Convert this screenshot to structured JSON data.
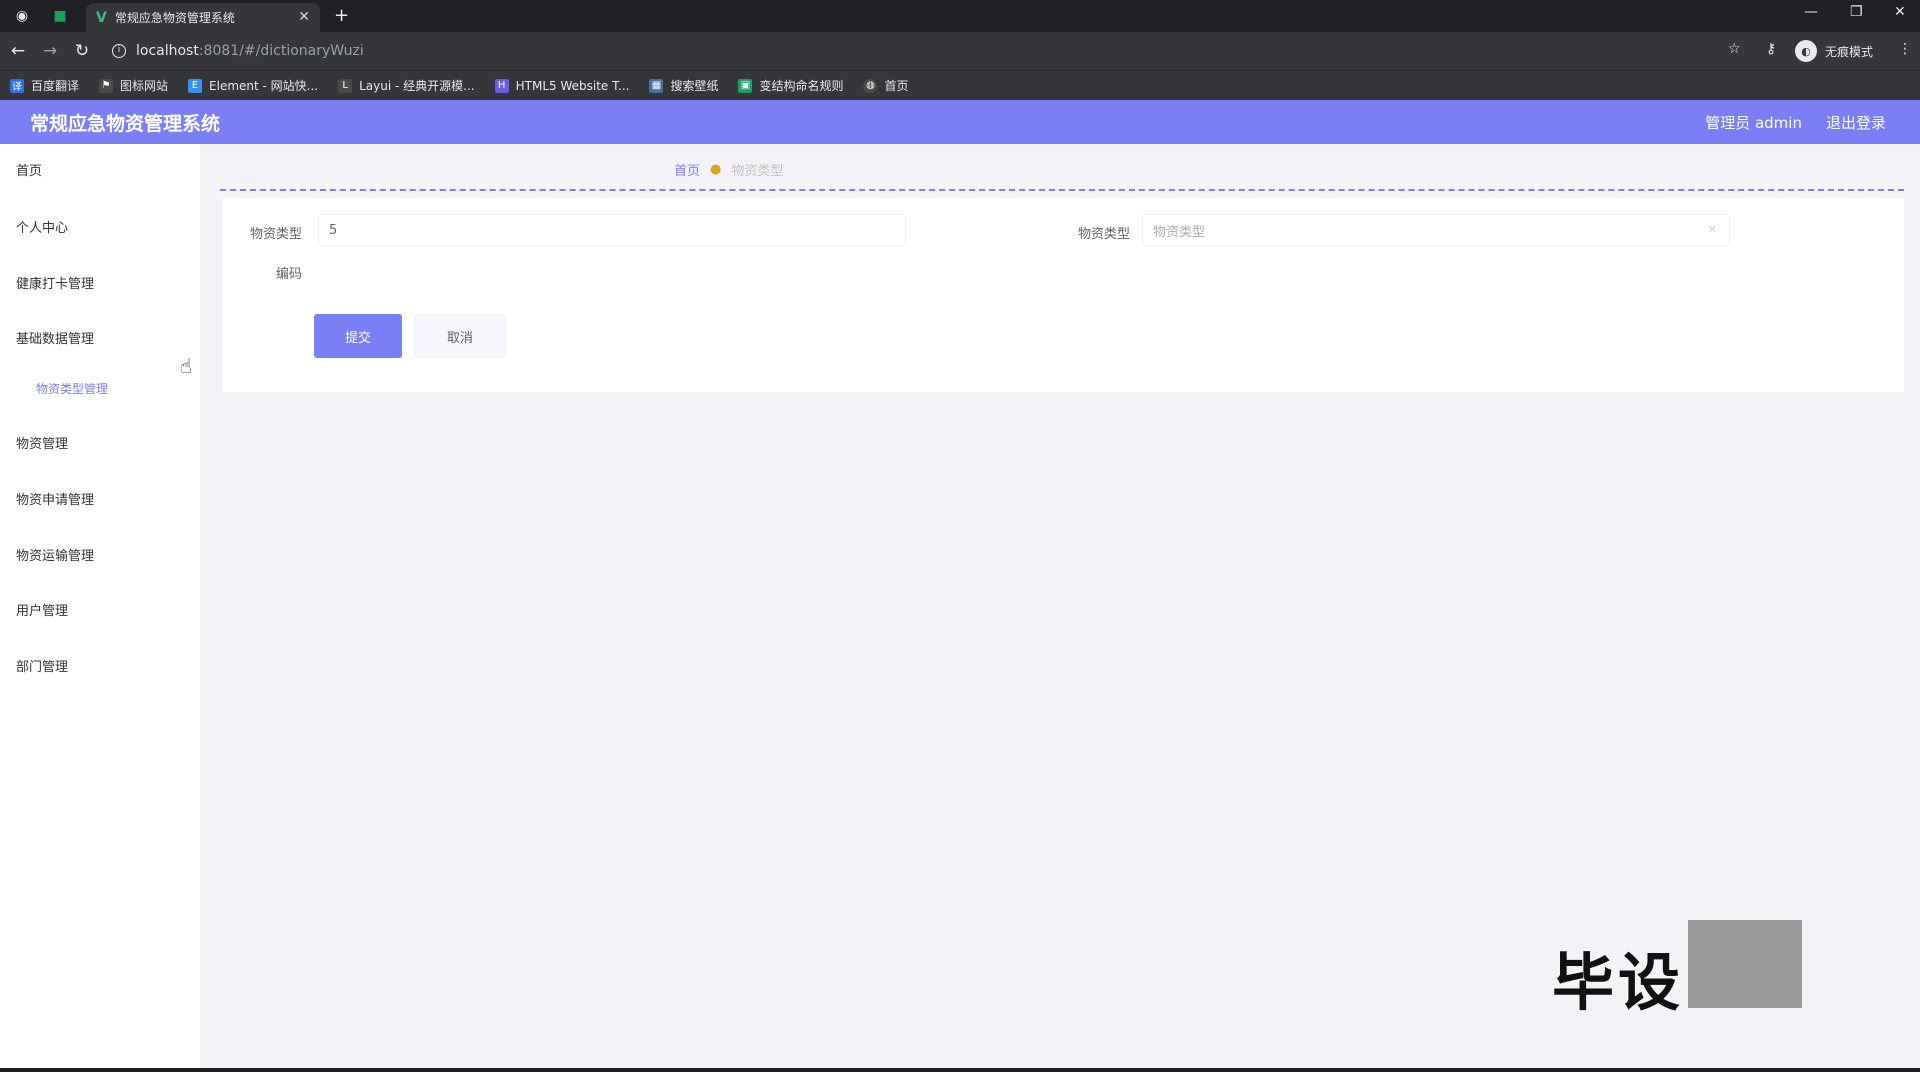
{
  "browser": {
    "tab_title": "常规应急物资管理系统",
    "url_host": "localhost",
    "url_path": ":8081/#/dictionaryWuzi",
    "incognito_label": "无痕模式",
    "bookmarks": [
      {
        "label": "百度翻译",
        "color": "#2f6fe4"
      },
      {
        "label": "图标网站",
        "color": "#4a4a4a"
      },
      {
        "label": "Element - 网站快...",
        "color": "#3d8ef0"
      },
      {
        "label": "Layui - 经典开源模...",
        "color": "#4a4a4a"
      },
      {
        "label": "HTML5 Website T...",
        "color": "#6c5ce7"
      },
      {
        "label": "搜索壁纸",
        "color": "#4a6fa5"
      },
      {
        "label": "变结构命名规则",
        "color": "#1aa260"
      },
      {
        "label": "首页",
        "color": "#4a4a4a"
      }
    ]
  },
  "header": {
    "title": "常规应急物资管理系统",
    "user": "管理员 admin",
    "logout": "退出登录",
    "accent": "#7b7ff5"
  },
  "sidebar": {
    "items": [
      {
        "label": "首页"
      },
      {
        "label": "个人中心"
      },
      {
        "label": "健康打卡管理"
      },
      {
        "label": "基础数据管理"
      },
      {
        "label": "物资管理"
      },
      {
        "label": "物资申请管理"
      },
      {
        "label": "物资运输管理"
      },
      {
        "label": "用户管理"
      },
      {
        "label": "部门管理"
      }
    ],
    "sub_item": "物资类型管理"
  },
  "breadcrumb": {
    "home": "首页",
    "current": "物资类型"
  },
  "form": {
    "field1_label": "物资类型",
    "field1_value": "5",
    "field2_label": "物资类型",
    "field2_placeholder": "物资类型",
    "field3_label": "编码",
    "submit": "提交",
    "cancel": "取消"
  },
  "watermark": {
    "text": "毕设"
  }
}
